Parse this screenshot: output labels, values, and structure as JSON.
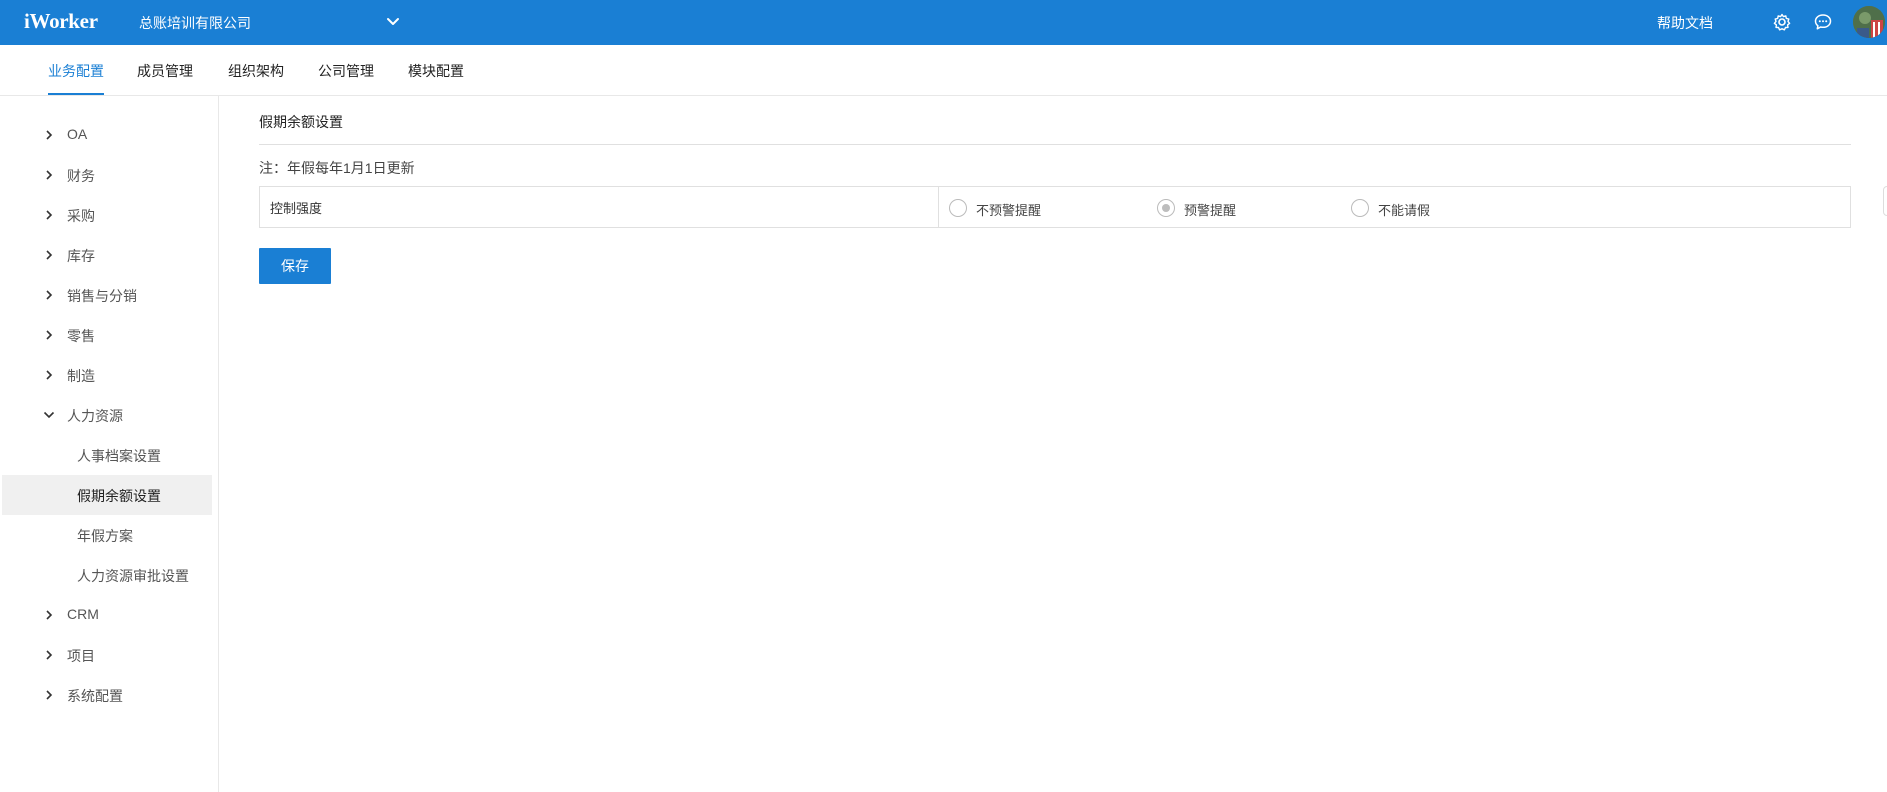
{
  "app": {
    "logo": "iWorker",
    "company": "总账培训有限公司",
    "help": "帮助文档"
  },
  "colors": {
    "primary": "#1a7fd4"
  },
  "tabs": [
    {
      "label": "业务配置",
      "active": true
    },
    {
      "label": "成员管理"
    },
    {
      "label": "组织架构"
    },
    {
      "label": "公司管理"
    },
    {
      "label": "模块配置"
    }
  ],
  "sidebar": {
    "items": [
      {
        "label": "OA"
      },
      {
        "label": "财务"
      },
      {
        "label": "采购"
      },
      {
        "label": "库存"
      },
      {
        "label": "销售与分销"
      },
      {
        "label": "零售"
      },
      {
        "label": "制造"
      },
      {
        "label": "人力资源",
        "expanded": true
      },
      {
        "label": "人事档案设置"
      },
      {
        "label": "假期余额设置",
        "active": true
      },
      {
        "label": "年假方案"
      },
      {
        "label": "人力资源审批设置"
      },
      {
        "label": "CRM"
      },
      {
        "label": "项目"
      },
      {
        "label": "系统配置"
      }
    ]
  },
  "main": {
    "title": "假期余额设置",
    "note": "注：年假每年1月1日更新",
    "setting": {
      "label": "控制强度",
      "options": [
        {
          "label": "不预警提醒",
          "checked": false
        },
        {
          "label": "预警提醒",
          "checked": true
        },
        {
          "label": "不能请假",
          "checked": false
        }
      ]
    },
    "save_label": "保存"
  },
  "icons": {
    "company_dropdown": "chevron-down-icon",
    "settings": "gear-icon",
    "messages": "chat-icon",
    "nav_collapsed": "chevron-right-icon",
    "nav_expanded": "chevron-down-icon"
  }
}
